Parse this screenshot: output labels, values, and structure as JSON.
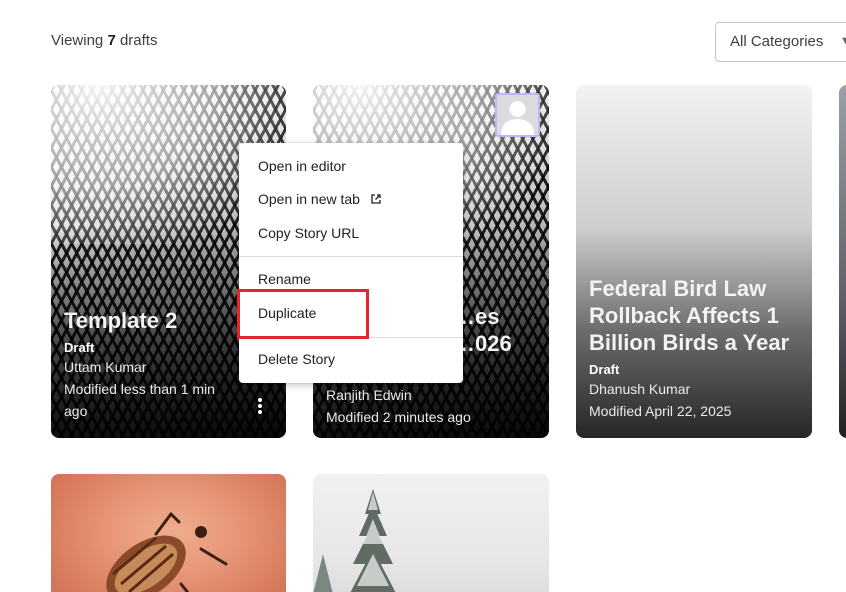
{
  "header": {
    "viewing_prefix": "Viewing",
    "draft_count": "7",
    "viewing_suffix": "drafts",
    "category_select": "All Categories"
  },
  "cards": [
    {
      "title": "Template 2",
      "status": "Draft",
      "author": "Uttam Kumar",
      "modified": "Modified less than 1 min ago"
    },
    {
      "title_line1": "…es",
      "title_line2": "…026",
      "author": "Ranjith Edwin",
      "modified": "Modified 2 minutes ago"
    },
    {
      "title": "Federal Bird Law Rollback Affects 1 Billion Birds a Year",
      "status": "Draft",
      "author": "Dhanush Kumar",
      "modified": "Modified April 22, 2025"
    }
  ],
  "context_menu": {
    "items": [
      "Open in editor",
      "Open in new tab",
      "Copy Story URL",
      "Rename",
      "Duplicate",
      "Delete Story"
    ],
    "icons": [
      "external-link-icon"
    ]
  },
  "colors": {
    "highlight": "#e5262b",
    "avatar_border": "#c5b3f5"
  }
}
